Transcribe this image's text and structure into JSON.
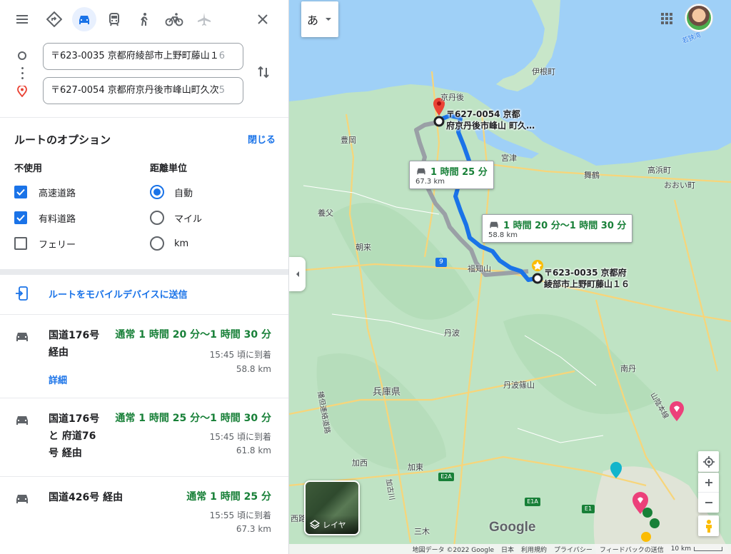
{
  "panel": {
    "modes": [
      "menu-icon",
      "best-route-icon",
      "car-icon",
      "transit-icon",
      "walk-icon",
      "bicycle-icon",
      "flight-icon",
      "close-icon"
    ],
    "origin": {
      "value_main": "〒623-0035 京都府綾部市上野町藤山１６",
      "value_rest": "",
      "value_start": "〒623-0035 京都府綾部市上野町藤山１",
      "value_end": "6"
    },
    "destination": {
      "value_start": "〒627-0054 京都府京丹後市峰山町久次",
      "value_end": "5"
    },
    "options": {
      "title": "ルートのオプション",
      "close": "閉じる",
      "avoid_header": "不使用",
      "avoid": [
        {
          "label": "高速道路",
          "checked": true
        },
        {
          "label": "有料道路",
          "checked": true
        },
        {
          "label": "フェリー",
          "checked": false
        }
      ],
      "unit_header": "距離単位",
      "units": [
        {
          "label": "自動",
          "selected": true
        },
        {
          "label": "マイル",
          "selected": false
        },
        {
          "label": "km",
          "selected": false
        }
      ]
    },
    "send_to_mobile": "ルートをモバイルデバイスに送信",
    "routes": [
      {
        "name": "国道176号\n経由",
        "duration": "通常 1 時間 20 分〜1 時間 30 分",
        "arrival": "15:45 頃に到着",
        "distance": "58.8 km",
        "detail": "詳細"
      },
      {
        "name": "国道176号\nと 府道76\n号 経由",
        "duration": "通常 1 時間 25 分〜1 時間 30 分",
        "arrival": "15:45 頃に到着",
        "distance": "61.8 km"
      },
      {
        "name": "国道426号 経由",
        "duration": "通常 1 時間 25 分",
        "arrival": "15:55 頃に到着",
        "distance": "67.3 km"
      }
    ]
  },
  "map": {
    "ime_label": "あ",
    "account_label": "若狭湾",
    "labels": {
      "ine": "伊根町",
      "kyotango": "京丹後",
      "toyooka": "豊岡",
      "miyazu": "宮津",
      "maizuru": "舞鶴",
      "takahama": "高浜町",
      "ooi": "おおい町",
      "yabu": "養父",
      "asago": "朝来",
      "fukuchiyama": "福知山",
      "tamba": "丹波",
      "hyogo": "兵庫県",
      "sasayama": "丹波篠山",
      "nantan": "南丹",
      "kasai": "加西",
      "kato": "加東",
      "miki": "三木",
      "route9": "9",
      "e1a": "E1A",
      "e2a": "E2A",
      "e1": "E1",
      "harima": "播但連絡道路",
      "kakogawa": "加古川",
      "sanin": "山陰本線",
      "ro": "西路"
    },
    "bubble_alt": {
      "time": "1 時間 25 分",
      "dist": "67.3 km"
    },
    "bubble_main": {
      "time": "1 時間 20 分〜1 時間 30 分",
      "dist": "58.8 km"
    },
    "dest_label": "〒627-0054 京都\n府京丹後市峰山 町久…",
    "origin_label": "〒623-0035 京都府\n綾部市上野町藤山１６",
    "layer_label": "レイヤ",
    "google": "Google",
    "footer": [
      "地図データ ©2022 Google",
      "日本",
      "利用規約",
      "プライバシー",
      "フィードバックの送信",
      "10 km"
    ],
    "colors": {
      "route": "#1a73e8",
      "alt_route": "#9aa0a6",
      "water": "#9fd0f7",
      "land": "#bfe3c4"
    }
  }
}
